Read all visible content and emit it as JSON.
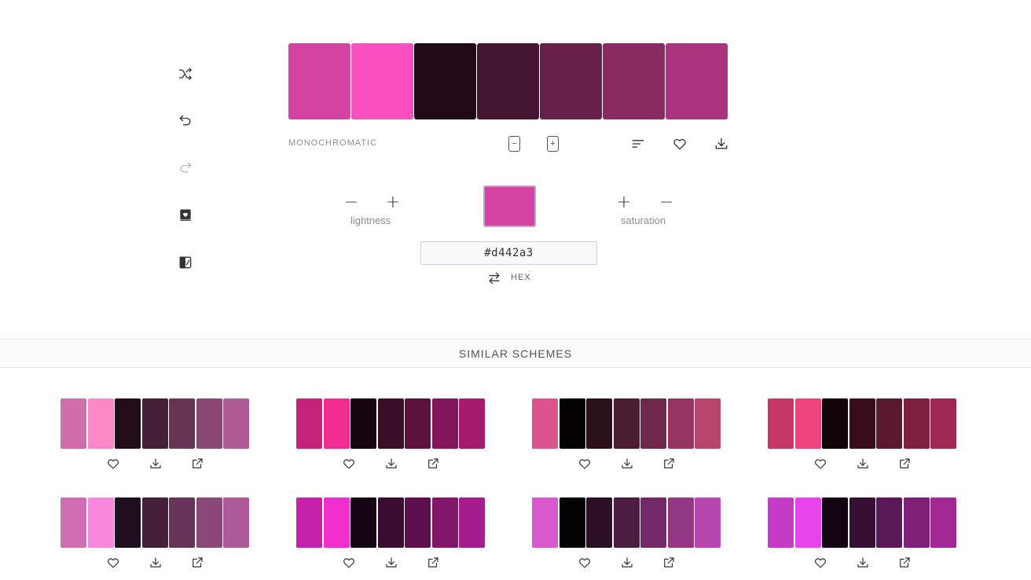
{
  "sidebar": {
    "items": [
      {
        "name": "shuffle-icon",
        "disabled": false
      },
      {
        "name": "undo-icon",
        "disabled": false
      },
      {
        "name": "redo-icon",
        "disabled": true
      },
      {
        "name": "saved-book-icon",
        "disabled": false
      },
      {
        "name": "library-icon",
        "disabled": false
      }
    ]
  },
  "palette": {
    "colors": [
      "#d442a3",
      "#f94fc0",
      "#220a18",
      "#451632",
      "#672049",
      "#892a62",
      "#ac347e"
    ],
    "scheme_label": "MONOCHROMATIC",
    "actions": {
      "minus_label": "−",
      "plus_label": "+"
    }
  },
  "adjust": {
    "lightness_label": "lightness",
    "saturation_label": "saturation",
    "minus": "−",
    "plus": "+"
  },
  "current": {
    "color": "#d442a3",
    "hex_value": "#d442a3",
    "format_label": "HEX"
  },
  "similar": {
    "title": "SIMILAR SCHEMES",
    "schemes": [
      [
        "#d06dab",
        "#fb88c8",
        "#200d18",
        "#442136",
        "#673453",
        "#8a4674",
        "#ad5b92"
      ],
      [
        "#c52378",
        "#f22d91",
        "#170511",
        "#3b0d27",
        "#5e103f",
        "#82165a",
        "#a51c6d"
      ],
      [
        "#db558c",
        "#050104",
        "#2a0f1c",
        "#4d1d33",
        "#70284a",
        "#943660",
        "#b7466f"
      ],
      [
        "#c4376a",
        "#ed4481",
        "#130406",
        "#370e1a",
        "#5b1832",
        "#7e203f",
        "#a12757"
      ],
      [
        "#d06eb4",
        "#f888dc",
        "#200d1d",
        "#442139",
        "#673459",
        "#8a4778",
        "#ad5b98"
      ],
      [
        "#c522ac",
        "#f12fce",
        "#160512",
        "#3b0b32",
        "#5e104e",
        "#82166b",
        "#a51c8d"
      ],
      [
        "#da58cd",
        "#040105",
        "#2b0f25",
        "#4e1d44",
        "#712a67",
        "#943785",
        "#b747ae"
      ],
      [
        "#c43bc6",
        "#e844ec",
        "#130412",
        "#370e34",
        "#5b1858",
        "#7e2078",
        "#a22896"
      ]
    ]
  }
}
